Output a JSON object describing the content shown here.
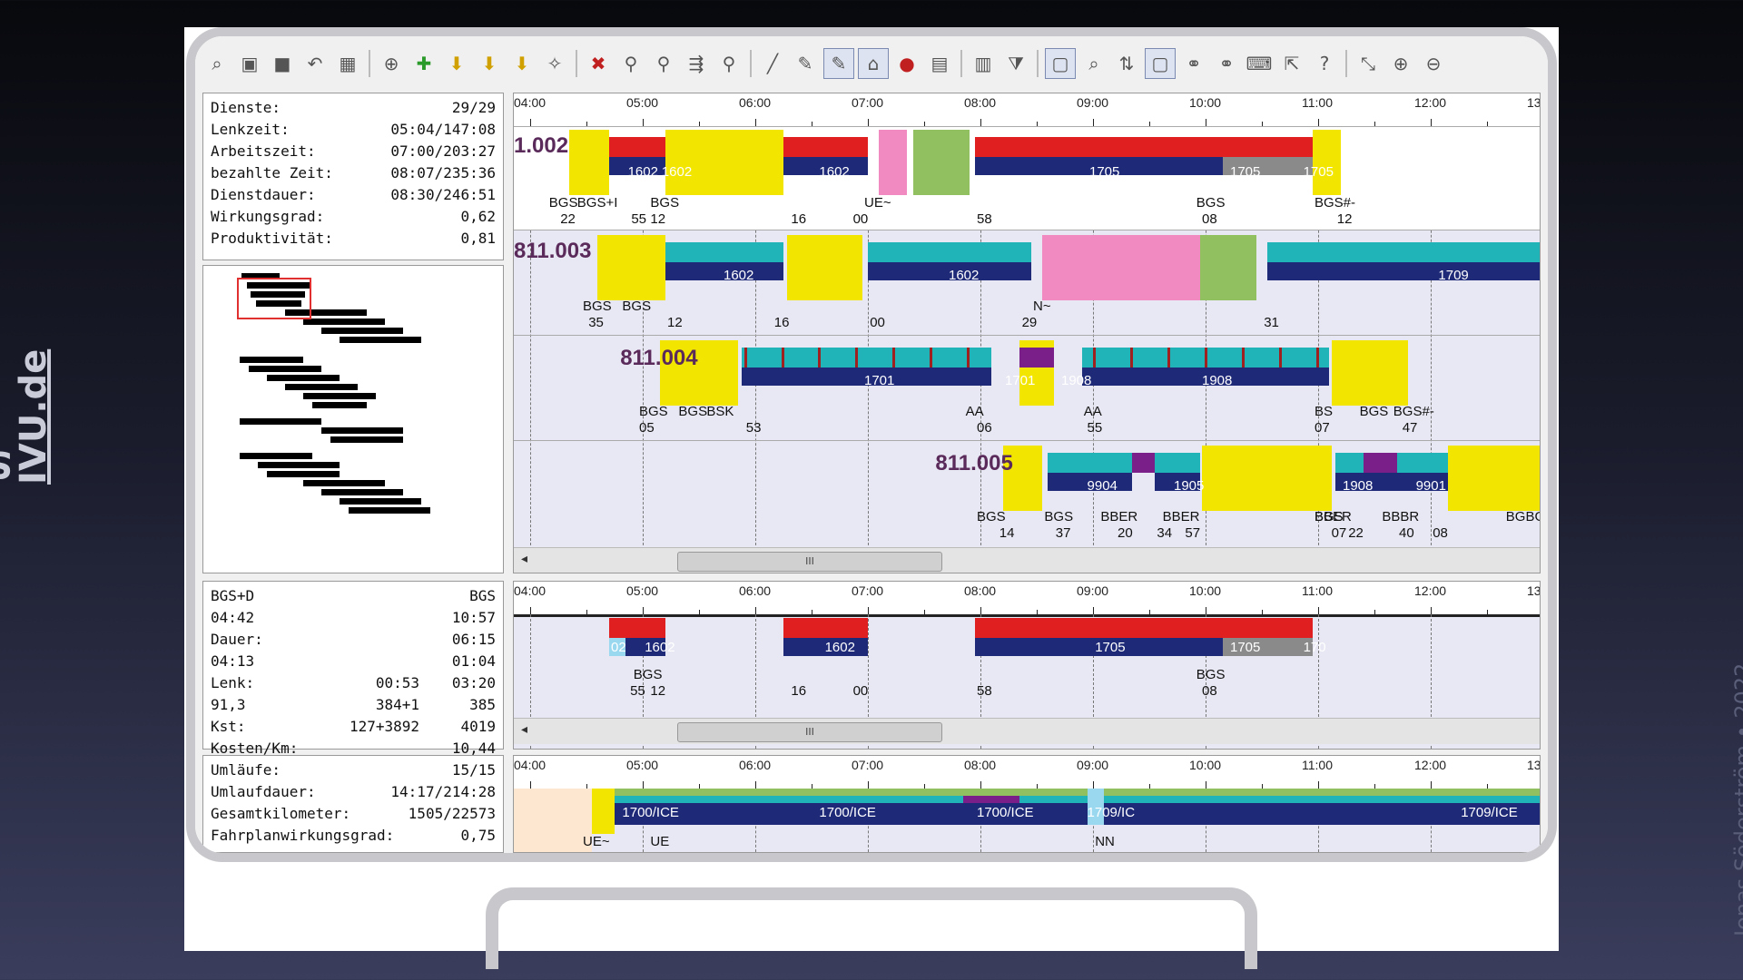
{
  "side_title": {
    "prefix": "Skärmbilder från ",
    "link": "IVU.de"
  },
  "credit": "Jonas Söderström • 2022",
  "colors": {
    "yellow": "#f2e600",
    "red": "#e02020",
    "navy": "#1e2a78",
    "teal": "#20b4b8",
    "pink": "#f08ac0",
    "green": "#90c060",
    "purple": "#7a1f8a",
    "gray": "#8a8a8a",
    "peach": "#fde7d0",
    "lightblue": "#9ad8f0"
  },
  "toolbar_icons": [
    "zoom-select-icon",
    "fit-icon",
    "save-icon",
    "undo-icon",
    "calc-icon",
    "add-doc-icon",
    "add-green-icon",
    "arrow-down-icon",
    "arrow-down2-icon",
    "arrow-down3-icon",
    "magic-icon",
    "delete-icon",
    "binoculars-icon",
    "binoculars2-icon",
    "split-icon",
    "binoculars3-icon",
    "pen-icon",
    "edit-icon",
    "edit2-icon",
    "home-icon",
    "stop-icon",
    "book-icon",
    "book2-icon",
    "filter-icon",
    "screen-icon",
    "magnify-icon",
    "sort-icon",
    "screen2-icon",
    "link-icon",
    "link2-icon",
    "keyboard-icon",
    "export-icon",
    "help-icon",
    "collapse-icon",
    "zoom-in-icon",
    "zoom-out-icon"
  ],
  "stats1": [
    {
      "label": "Dienste:",
      "value": "29/29"
    },
    {
      "label": "Lenkzeit:",
      "value": "05:04/147:08"
    },
    {
      "label": "Arbeitszeit:",
      "value": "07:00/203:27"
    },
    {
      "label": "bezahlte Zeit:",
      "value": "08:07/235:36"
    },
    {
      "label": "Dienstdauer:",
      "value": "08:30/246:51"
    },
    {
      "label": "Wirkungsgrad:",
      "value": "0,62"
    },
    {
      "label": "Produktivität:",
      "value": "0,81"
    }
  ],
  "stats2": [
    {
      "a": "BGS+D",
      "b": "",
      "c": "BGS"
    },
    {
      "a": "04:42",
      "b": "",
      "c": "10:57"
    },
    {
      "a": "Dauer:",
      "b": "",
      "c": "06:15"
    },
    {
      "a": "04:13",
      "b": "",
      "c": "01:04"
    },
    {
      "a": "Lenk:",
      "b": "00:53",
      "c": "03:20"
    },
    {
      "a": "91,3",
      "b": "384+1",
      "c": "385"
    },
    {
      "a": "Kst:",
      "b": "127+3892",
      "c": "4019"
    },
    {
      "a": "Kosten/Km:",
      "b": "",
      "c": "10,44"
    }
  ],
  "stats3": [
    {
      "label": "Umläufe:",
      "value": "15/15"
    },
    {
      "label": "Umlaufdauer:",
      "value": "14:17/214:28"
    },
    {
      "label": "Gesamtkilometer:",
      "value": "1505/22573"
    },
    {
      "label": "Fahrplanwirkungsgrad:",
      "value": "0,75"
    }
  ],
  "time_ticks": [
    "04:00",
    "05:00",
    "06:00",
    "07:00",
    "08:00",
    "09:00",
    "10:00",
    "11:00",
    "12:00",
    "13:00"
  ],
  "duties": [
    {
      "name": "1.002",
      "labels": [
        {
          "t": "1602",
          "x": 4.9
        },
        {
          "t": "1602",
          "x": 5.2
        },
        {
          "t": "1602",
          "x": 6.6
        },
        {
          "t": "1705",
          "x": 9.0
        },
        {
          "t": "1705",
          "x": 10.25
        },
        {
          "t": "1705",
          "x": 10.9
        }
      ],
      "bottom": [
        {
          "t": "BGS",
          "x": 4.2
        },
        {
          "t": "BGS+I",
          "x": 4.45
        },
        {
          "t": "BGS",
          "x": 5.1
        },
        {
          "t": "UE~",
          "x": 7.0
        },
        {
          "t": "BGS",
          "x": 9.95
        },
        {
          "t": "BGS#-",
          "x": 11.0
        }
      ],
      "nums": [
        {
          "t": "22",
          "x": 4.3
        },
        {
          "t": "55",
          "x": 4.93
        },
        {
          "t": "12",
          "x": 5.1
        },
        {
          "t": "16",
          "x": 6.35
        },
        {
          "t": "00",
          "x": 6.9
        },
        {
          "t": "58",
          "x": 8.0
        },
        {
          "t": "08",
          "x": 10.0
        },
        {
          "t": "12",
          "x": 11.2
        }
      ]
    },
    {
      "name": "811.003",
      "labels": [
        {
          "t": "1602",
          "x": 5.75
        },
        {
          "t": "1602",
          "x": 7.75
        },
        {
          "t": "1709",
          "x": 12.1
        }
      ],
      "bottom": [
        {
          "t": "BGS",
          "x": 4.5
        },
        {
          "t": "BGS",
          "x": 4.85
        },
        {
          "t": "N~",
          "x": 8.5
        }
      ],
      "nums": [
        {
          "t": "35",
          "x": 4.55
        },
        {
          "t": "12",
          "x": 5.25
        },
        {
          "t": "16",
          "x": 6.2
        },
        {
          "t": "00",
          "x": 7.05
        },
        {
          "t": "29",
          "x": 8.4
        },
        {
          "t": "31",
          "x": 10.55
        }
      ]
    },
    {
      "name": "811.004",
      "labels": [
        {
          "t": "1701",
          "x": 7.0
        },
        {
          "t": "1701",
          "x": 8.25
        },
        {
          "t": "1908",
          "x": 8.75
        },
        {
          "t": "1908",
          "x": 10.0
        }
      ],
      "bottom": [
        {
          "t": "BGS",
          "x": 5.0
        },
        {
          "t": "BGS",
          "x": 5.35
        },
        {
          "t": "BSK",
          "x": 5.6
        },
        {
          "t": "AA",
          "x": 7.9
        },
        {
          "t": "AA",
          "x": 8.95
        },
        {
          "t": "BS",
          "x": 11.0
        },
        {
          "t": "BGS",
          "x": 11.4
        },
        {
          "t": "BGS#-",
          "x": 11.7
        }
      ],
      "nums": [
        {
          "t": "05",
          "x": 5.0
        },
        {
          "t": "53",
          "x": 5.95
        },
        {
          "t": "06",
          "x": 8.0
        },
        {
          "t": "55",
          "x": 8.98
        },
        {
          "t": "07",
          "x": 11.0
        },
        {
          "t": "47",
          "x": 11.78
        }
      ]
    },
    {
      "name": "811.005",
      "labels": [
        {
          "t": "9904",
          "x": 8.98
        },
        {
          "t": "1905",
          "x": 9.75
        },
        {
          "t": "1908",
          "x": 11.25
        },
        {
          "t": "9901",
          "x": 11.9
        }
      ],
      "bottom": [
        {
          "t": "BGS",
          "x": 8.0
        },
        {
          "t": "BGS",
          "x": 8.6
        },
        {
          "t": "BBER",
          "x": 9.1
        },
        {
          "t": "BBER",
          "x": 9.65
        },
        {
          "t": "BGS",
          "x": 11.0
        },
        {
          "t": "BBER",
          "x": 11.0
        },
        {
          "t": "BBBR",
          "x": 11.6
        },
        {
          "t": "BGBGS",
          "x": 12.7
        }
      ],
      "nums": [
        {
          "t": "14",
          "x": 8.2
        },
        {
          "t": "37",
          "x": 8.7
        },
        {
          "t": "20",
          "x": 9.25
        },
        {
          "t": "34",
          "x": 9.6
        },
        {
          "t": "57",
          "x": 9.85
        },
        {
          "t": "07",
          "x": 11.15
        },
        {
          "t": "22",
          "x": 11.3
        },
        {
          "t": "40",
          "x": 11.75
        },
        {
          "t": "08",
          "x": 12.05
        },
        {
          "t": "04",
          "x": 13.0
        }
      ]
    }
  ],
  "detail": {
    "labels": [
      {
        "t": "02",
        "x": 4.75
      },
      {
        "t": "1602",
        "x": 5.05
      },
      {
        "t": "1602",
        "x": 6.65
      },
      {
        "t": "1705",
        "x": 9.05
      },
      {
        "t": "1705",
        "x": 10.25
      },
      {
        "t": "170",
        "x": 10.9
      }
    ],
    "bottom": [
      {
        "t": "BGS",
        "x": 4.95
      },
      {
        "t": "BGS",
        "x": 9.95
      }
    ],
    "nums": [
      {
        "t": "55",
        "x": 4.92
      },
      {
        "t": "12",
        "x": 5.1
      },
      {
        "t": "16",
        "x": 6.35
      },
      {
        "t": "00",
        "x": 6.9
      },
      {
        "t": "58",
        "x": 8.0
      },
      {
        "t": "08",
        "x": 10.0
      }
    ]
  },
  "rotation": {
    "labels": [
      {
        "t": "1700/ICE",
        "x": 4.85
      },
      {
        "t": "1700/ICE",
        "x": 6.6
      },
      {
        "t": "1700/ICE",
        "x": 8.0
      },
      {
        "t": "1709/IC",
        "x": 8.98
      },
      {
        "t": "1709/ICE",
        "x": 12.3
      }
    ],
    "bottom": [
      {
        "t": "UE~",
        "x": 4.5
      },
      {
        "t": "UE",
        "x": 5.1
      },
      {
        "t": "NN",
        "x": 9.05
      }
    ]
  },
  "scroll_thumb": "III"
}
